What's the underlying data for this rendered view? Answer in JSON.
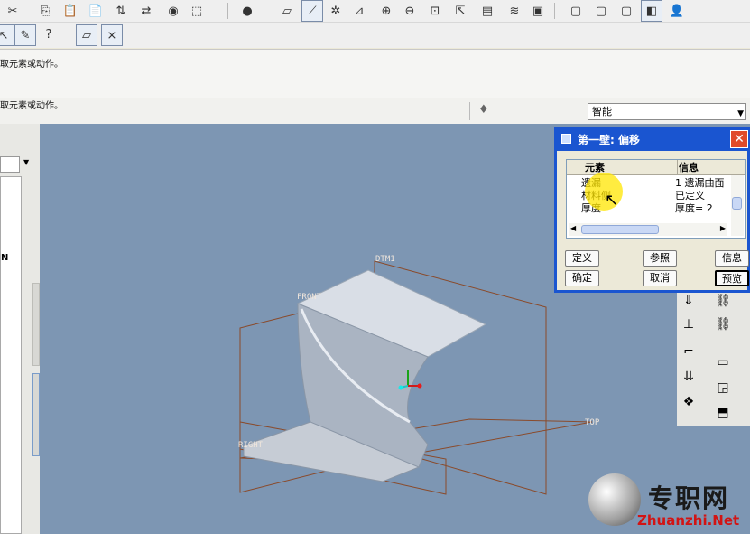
{
  "messages": {
    "line1": "取元素或动作。",
    "line2": "取元素或动作。"
  },
  "filter": {
    "value": "智能"
  },
  "dialog": {
    "title": "第一壁: 偏移",
    "close": "✕",
    "columns": {
      "element": "元素",
      "info": "信息"
    },
    "rows": [
      {
        "element": "遗漏",
        "info": "1 遗漏曲面"
      },
      {
        "element": "材料侧",
        "info": "已定义"
      },
      {
        "element": "厚度",
        "info": "厚度= 2"
      }
    ],
    "buttons": {
      "define": "定义",
      "refs": "参照",
      "info": "信息",
      "ok": "确定",
      "cancel": "取消",
      "preview": "预览"
    }
  },
  "model": {
    "datum_labels": {
      "dtm1": "DTM1",
      "front": "FRONT",
      "top": "TOP",
      "right": "RIGHT"
    }
  },
  "watermark": {
    "cn": "专职网",
    "en": "Zhuanzhi.Net"
  },
  "leftpanel": {
    "letter": "N"
  },
  "colors": {
    "viewport_bg": "#7d96b3",
    "datum_color": "#8a4a2a",
    "dialog_title": "#1a55d0",
    "highlight": "#ffe600"
  }
}
